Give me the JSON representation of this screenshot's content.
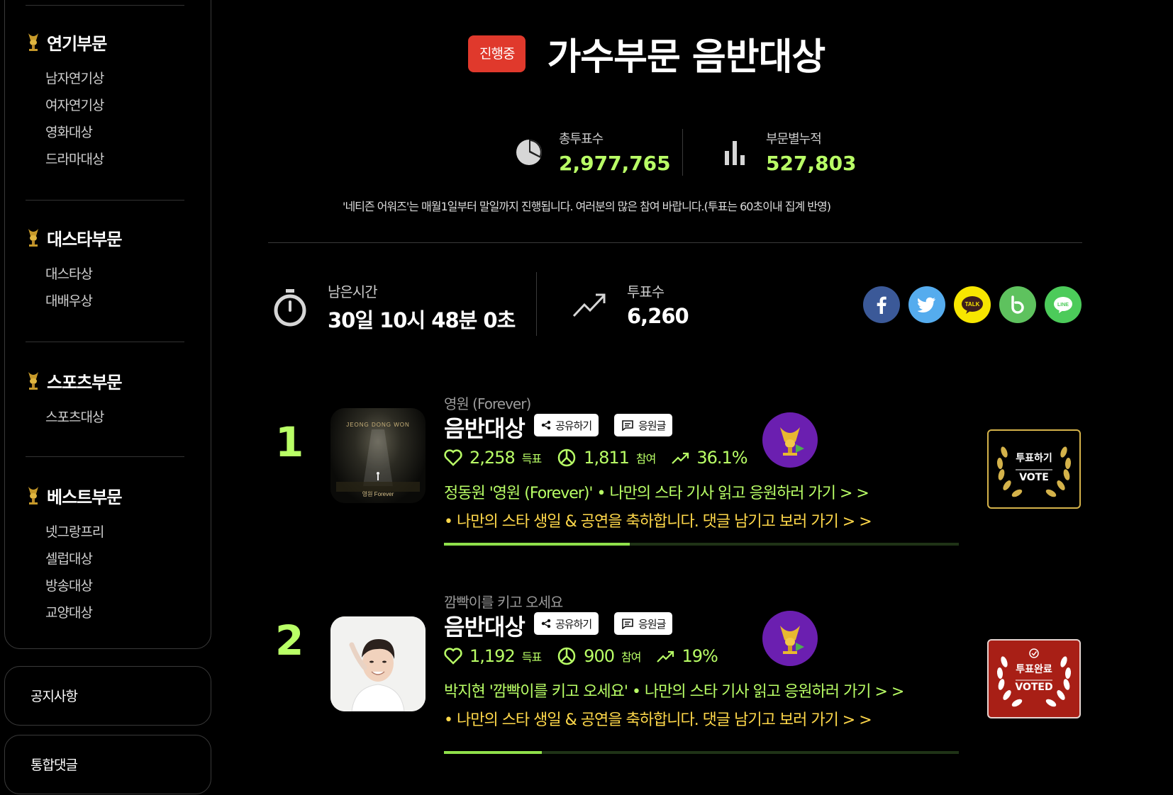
{
  "sidebar": {
    "sections": [
      {
        "title": "연기부문",
        "items": [
          "남자연기상",
          "여자연기상",
          "영화대상",
          "드라마대상"
        ]
      },
      {
        "title": "대스타부문",
        "items": [
          "대스타상",
          "대배우상"
        ]
      },
      {
        "title": "스포츠부문",
        "items": [
          "스포츠대상"
        ]
      },
      {
        "title": "베스트부문",
        "items": [
          "넷그랑프리",
          "셀럽대상",
          "방송대상",
          "교양대상"
        ]
      }
    ],
    "notice": "공지사항",
    "comments": "통합댓글"
  },
  "header": {
    "status": "진행중",
    "title": "가수부문  음반대상"
  },
  "stats": {
    "total_label": "총투표수",
    "total_value": "2,977,765",
    "cumulative_label": "부문별누적",
    "cumulative_value": "527,803"
  },
  "notice": "'네티즌 어워즈'는 매월1일부터 말일까지 진행됩니다. 여러분의 많은 참여 바랍니다.(투표는 60초이내 집계 반영)",
  "timer": {
    "label": "남은시간",
    "value": "30일 10시 48분 0초"
  },
  "votes": {
    "label": "투표수",
    "value": "6,260"
  },
  "social": [
    "facebook-icon",
    "twitter-icon",
    "kakaotalk-icon",
    "band-icon",
    "line-icon"
  ],
  "colors": {
    "accent": "#b9ff66",
    "live_badge": "#e0392c",
    "facebook": "#3b5998",
    "twitter": "#55acee",
    "kakaotalk": "#f7e600",
    "band": "#5ec25e",
    "line": "#4ccb5a",
    "vote_gold": "#d4b24a",
    "voted_red": "#a81f16"
  },
  "entries": [
    {
      "rank": "1",
      "song": "영원 (Forever)",
      "category": "음반대상",
      "share": "공유하기",
      "cheer": "응원글",
      "likes": "2,258",
      "likes_unit": "득표",
      "participants": "1,811",
      "participants_unit": "참여",
      "percent": "36.1%",
      "progress": 0.361,
      "link1": "정동원 '영원 (Forever)' • 나만의 스타 기사 읽고 응원하러 가기 > >",
      "link2": "• 나만의 스타 생일 & 공연을 축하합니다. 댓글 남기고 보러 가기 > >",
      "vote_label": "투표하기",
      "vote_sub": "VOTE",
      "voted": false
    },
    {
      "rank": "2",
      "song": "깜빡이를 키고 오세요",
      "category": "음반대상",
      "share": "공유하기",
      "cheer": "응원글",
      "likes": "1,192",
      "likes_unit": "득표",
      "participants": "900",
      "participants_unit": "참여",
      "percent": "19%",
      "progress": 0.19,
      "link1": "박지현 '깜빡이를 키고 오세요' • 나만의 스타 기사 읽고 응원하러 가기 > >",
      "link2": "• 나만의 스타 생일 & 공연을 축하합니다. 댓글 남기고 보러 가기 > >",
      "vote_label": "투표완료",
      "vote_sub": "VOTED",
      "voted": true
    }
  ]
}
